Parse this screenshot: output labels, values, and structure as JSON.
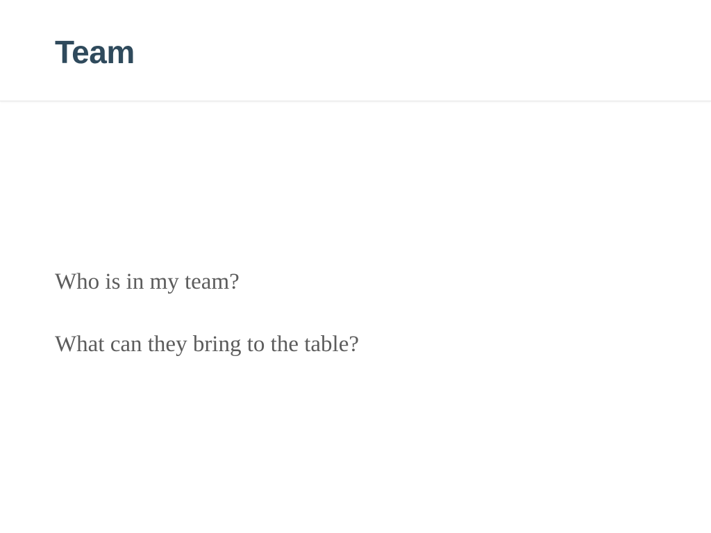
{
  "slide": {
    "title": "Team",
    "lines": [
      "Who is in my team?",
      "What can they bring to the table?"
    ]
  },
  "colors": {
    "title": "#2f4a5c",
    "body_text": "#5c5c5c",
    "background": "#ffffff"
  }
}
